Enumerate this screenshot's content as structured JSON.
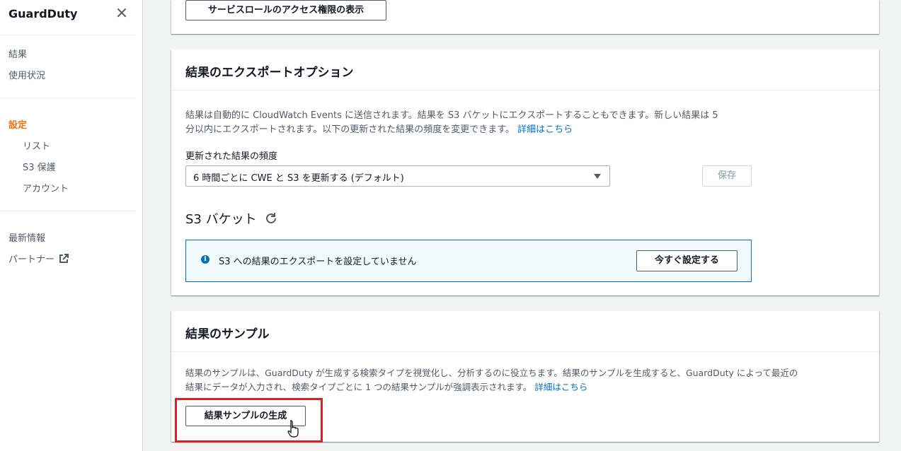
{
  "sidebar": {
    "title": "GuardDuty",
    "items": [
      {
        "label": "結果"
      },
      {
        "label": "使用状況"
      },
      {
        "label": "設定"
      },
      {
        "label": "リスト"
      },
      {
        "label": "S3 保護"
      },
      {
        "label": "アカウント"
      },
      {
        "label": "最新情報"
      },
      {
        "label": "パートナー"
      }
    ],
    "active_color": "#ec7211"
  },
  "service_role": {
    "button_label": "サービスロールのアクセス権限の表示"
  },
  "export": {
    "title": "結果のエクスポートオプション",
    "description_line1": "結果は自動的に CloudWatch Events に送信されます。結果を S3 バケットにエクスポートすることもできます。新しい結果は 5",
    "description_line2": "分以内にエクスポートされます。以下の更新された結果の頻度を変更できます。",
    "learn_more": "詳細はこちら",
    "frequency_label": "更新された結果の頻度",
    "frequency_value": "6 時間ごとに CWE と S3 を更新する (デフォルト)",
    "save_label": "保存",
    "s3_title": "S3 バケット",
    "info_text": "S3 への結果のエクスポートを設定していません",
    "configure_label": "今すぐ設定する"
  },
  "sample": {
    "title": "結果のサンプル",
    "description_line1": "結果のサンプルは、GuardDuty が生成する検索タイプを視覚化し、分析するのに役立ちます。結果のサンプルを生成すると、GuardDuty によって最近の",
    "description_line2": "結果にデータが入力され、検索タイプごとに 1 つの結果サンプルが強調表示されます。",
    "learn_more": "詳細はこちら",
    "generate_label": "結果サンプルの生成"
  },
  "colors": {
    "link": "#0073bb",
    "highlight": "#e02020"
  }
}
